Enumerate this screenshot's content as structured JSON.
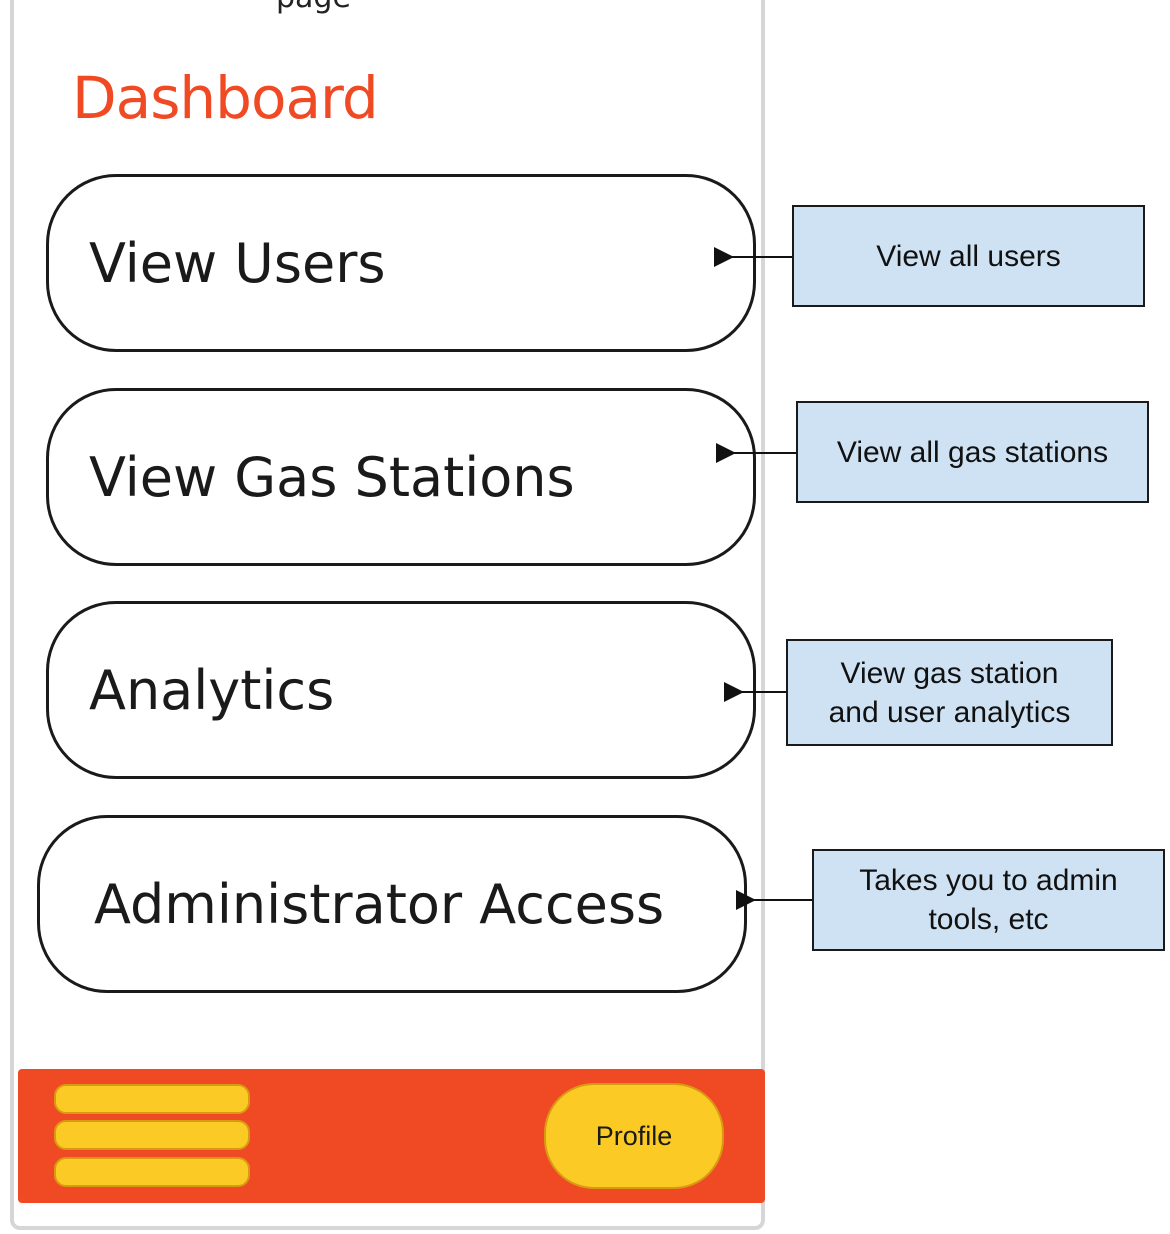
{
  "header": {
    "cutoff_text": "page",
    "title": "Dashboard"
  },
  "menu": {
    "items": [
      {
        "label": "View Users"
      },
      {
        "label": "View Gas Stations"
      },
      {
        "label": "Analytics"
      },
      {
        "label": "Administrator Access"
      }
    ]
  },
  "annotations": [
    {
      "text": "View all users"
    },
    {
      "text": "View all gas stations"
    },
    {
      "text": "View gas station and user analytics"
    },
    {
      "text": "Takes you to admin tools, etc"
    }
  ],
  "footer": {
    "menu_icon": "hamburger-menu-icon",
    "profile_label": "Profile"
  },
  "colors": {
    "accent": "#f04a24",
    "button_yellow": "#fcca24",
    "callout_fill": "#cfe2f3"
  }
}
